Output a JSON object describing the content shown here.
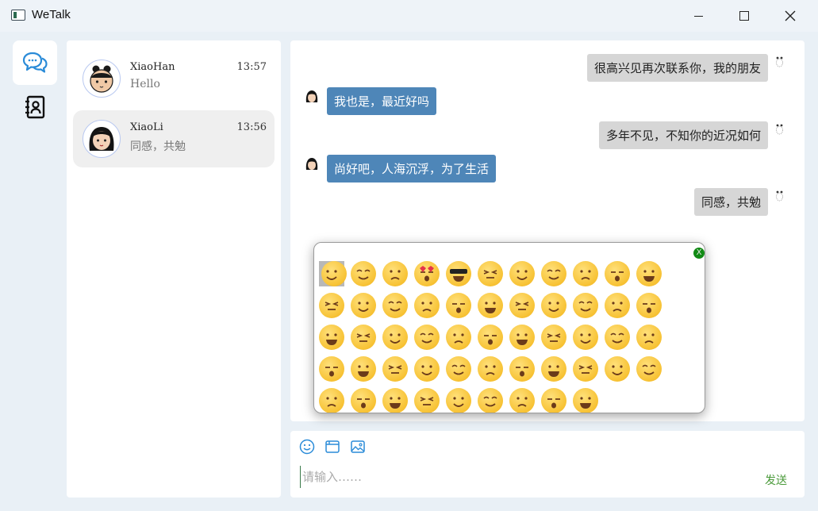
{
  "window": {
    "title": "WeTalk"
  },
  "nav": [
    {
      "name": "chat-nav",
      "icon": "chat-bubbles-icon",
      "active": true
    },
    {
      "name": "contacts-nav",
      "icon": "contact-book-icon",
      "active": false
    }
  ],
  "conversations": [
    {
      "name": "XiaoHan",
      "time": "13:57",
      "last": "Hello",
      "selected": false
    },
    {
      "name": "XiaoLi",
      "time": "13:56",
      "last": "同感，共勉",
      "selected": true
    }
  ],
  "messages": [
    {
      "from": "me",
      "text": "很高兴见再次联系你，我的朋友"
    },
    {
      "from": "other",
      "text": "我也是，最近好吗"
    },
    {
      "from": "me",
      "text": "多年不见，不知你的近况如何"
    },
    {
      "from": "other",
      "text": "尚好吧，人海沉浮，为了生活"
    },
    {
      "from": "me",
      "text": "同感，共勉"
    }
  ],
  "emoji_panel": {
    "close_label": "X",
    "count": 53
  },
  "input": {
    "placeholder": "请输入……",
    "send_label": "发送"
  },
  "colors": {
    "accent": "#2a8bd8",
    "other_bubble": "#4e86b8",
    "me_bubble": "#d6d6d6",
    "send": "#4a9a3a"
  }
}
